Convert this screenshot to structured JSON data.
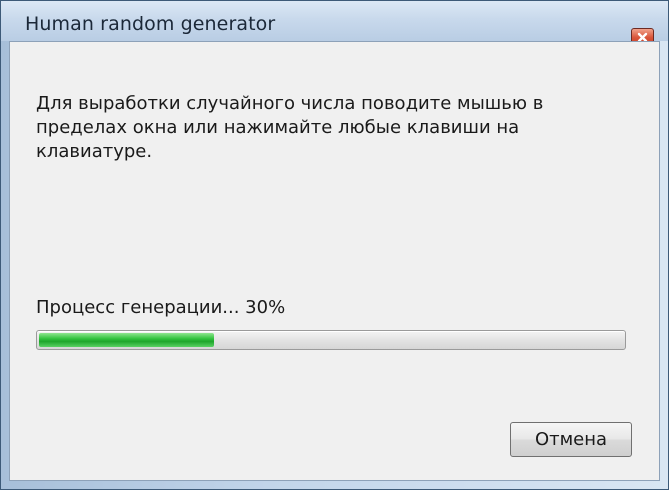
{
  "window": {
    "title": "Human random generator"
  },
  "dialog": {
    "message": "Для выработки случайного числа поводите мышью в пределах окна или нажимайте любые клавиши на клавиатуре.",
    "progress_label": "Процесс генерации... 30%",
    "progress_percent": 30,
    "cancel_label": "Отмена"
  },
  "titlebar_buttons": {
    "close_icon": "close-icon"
  },
  "colors": {
    "close_button": "#d9553a",
    "progress_fill": "#33c43f",
    "client_background": "#f0f0f0"
  }
}
